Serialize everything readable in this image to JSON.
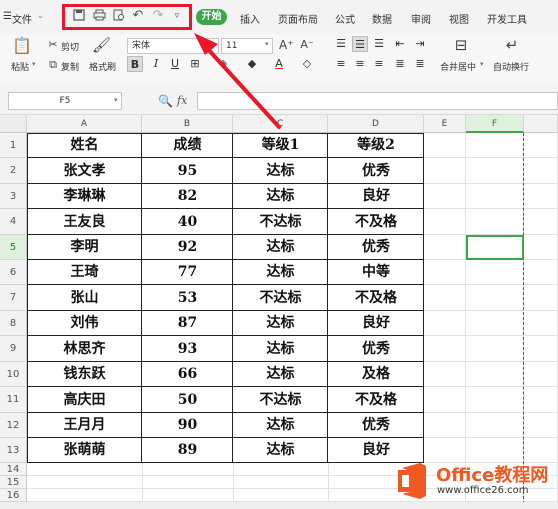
{
  "menu": {
    "file_label": "文件"
  },
  "tabs": [
    {
      "label": "开始",
      "active": true
    },
    {
      "label": "插入"
    },
    {
      "label": "页面布局"
    },
    {
      "label": "公式"
    },
    {
      "label": "数据"
    },
    {
      "label": "审阅"
    },
    {
      "label": "视图"
    },
    {
      "label": "开发工具"
    }
  ],
  "ribbon": {
    "paste": "粘贴",
    "cut": "剪切",
    "copy": "复制",
    "format_painter": "格式刷",
    "font_name": "宋体",
    "font_size": "11",
    "merge_center": "合并居中",
    "wrap_text": "自动换行"
  },
  "formula_bar": {
    "name_box": "F5",
    "fx": "fx"
  },
  "columns": [
    "A",
    "B",
    "C",
    "D",
    "E",
    "F"
  ],
  "rows": [
    "1",
    "2",
    "3",
    "4",
    "5",
    "6",
    "7",
    "8",
    "9",
    "10",
    "11",
    "12",
    "13",
    "14",
    "15",
    "16"
  ],
  "table": {
    "headers": [
      "姓名",
      "成绩",
      "等级1",
      "等级2"
    ],
    "data": [
      [
        "张文孝",
        "95",
        "达标",
        "优秀"
      ],
      [
        "李琳琳",
        "82",
        "达标",
        "良好"
      ],
      [
        "王友良",
        "40",
        "不达标",
        "不及格"
      ],
      [
        "李明",
        "92",
        "达标",
        "优秀"
      ],
      [
        "王琦",
        "77",
        "达标",
        "中等"
      ],
      [
        "张山",
        "53",
        "不达标",
        "不及格"
      ],
      [
        "刘伟",
        "87",
        "达标",
        "良好"
      ],
      [
        "林思齐",
        "93",
        "达标",
        "优秀"
      ],
      [
        "钱东跃",
        "66",
        "达标",
        "及格"
      ],
      [
        "高庆田",
        "50",
        "不达标",
        "不及格"
      ],
      [
        "王月月",
        "90",
        "达标",
        "优秀"
      ],
      [
        "张萌萌",
        "89",
        "达标",
        "良好"
      ]
    ]
  },
  "watermark": {
    "title": "Office教程网",
    "url": "www.office26.com"
  },
  "colors": {
    "accent": "#3ea44a",
    "highlight": "#e8182a",
    "watermark": "#f05a22"
  }
}
